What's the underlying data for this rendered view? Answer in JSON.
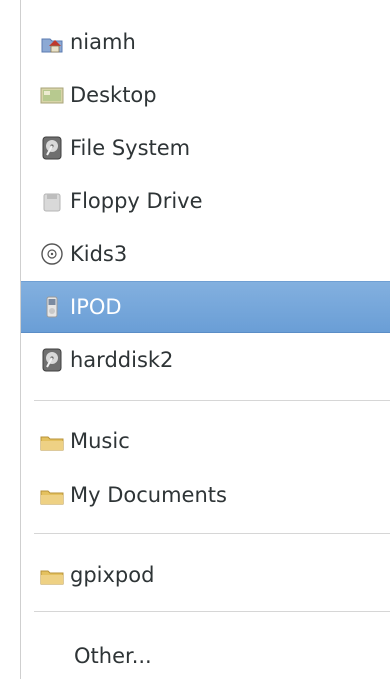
{
  "menu": {
    "items": [
      {
        "label": "niamh",
        "icon": "home-folder-icon"
      },
      {
        "label": "Desktop",
        "icon": "desktop-icon"
      },
      {
        "label": "File System",
        "icon": "harddisk-icon"
      },
      {
        "label": "Floppy Drive",
        "icon": "floppy-drive-icon"
      },
      {
        "label": "Kids3",
        "icon": "optical-disc-icon"
      },
      {
        "label": "IPOD",
        "icon": "ipod-icon",
        "selected": true
      },
      {
        "label": "harddisk2",
        "icon": "harddisk-icon"
      },
      {
        "label": "Music",
        "icon": "folder-icon"
      },
      {
        "label": "My Documents",
        "icon": "folder-icon"
      },
      {
        "label": "gpixpod",
        "icon": "folder-icon"
      },
      {
        "label": "Other...",
        "icon": ""
      }
    ]
  },
  "colors": {
    "selection": "#6a9ed6",
    "text": "#2e3436",
    "selected_text": "#ffffff",
    "separator": "#d6d6d6"
  }
}
